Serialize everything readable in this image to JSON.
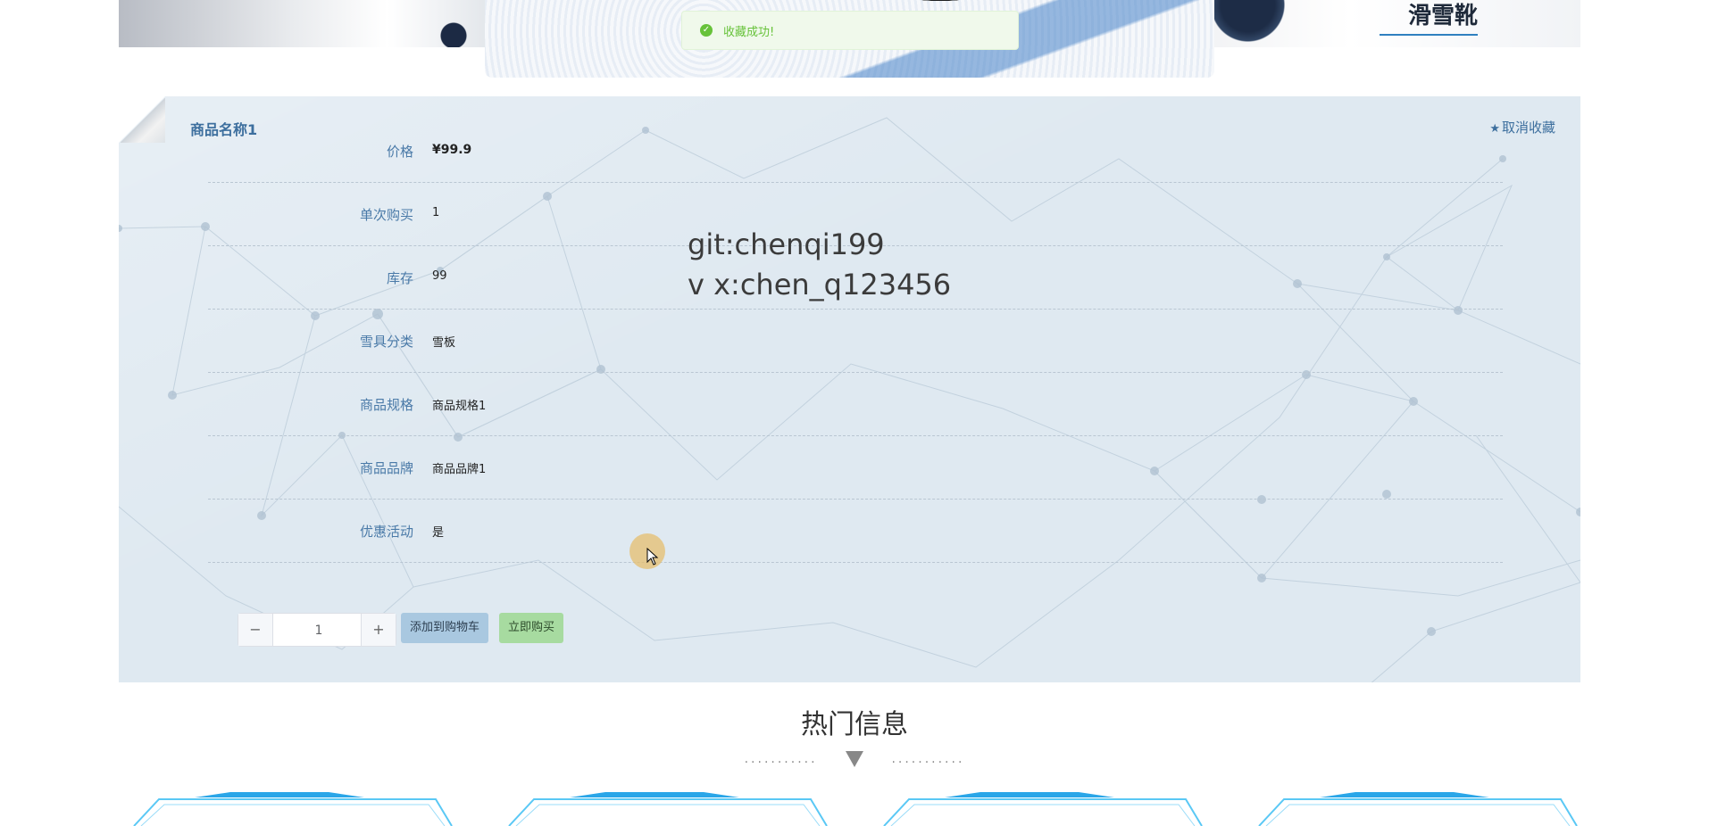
{
  "banner": {
    "right_title": "滑雪靴"
  },
  "toast": {
    "message": "收藏成功!"
  },
  "product": {
    "title": "商品名称1",
    "unfavorite_label": "取消收藏",
    "fields": [
      {
        "label": "价格",
        "value": "¥99.9"
      },
      {
        "label": "单次购买",
        "value": "1"
      },
      {
        "label": "库存",
        "value": "99"
      },
      {
        "label": "雪具分类",
        "value": "雪板"
      },
      {
        "label": "商品规格",
        "value": "商品规格1"
      },
      {
        "label": "商品品牌",
        "value": "商品品牌1"
      },
      {
        "label": "优惠活动",
        "value": "是"
      }
    ],
    "quantity": "1",
    "add_to_cart_label": "添加到购物车",
    "buy_now_label": "立即购买"
  },
  "watermark": {
    "line1": "git:chenqi199",
    "line2": "v x:chen_q123456"
  },
  "hot_section": {
    "title": "热门信息",
    "dots_left": "...........",
    "dots_right": "..........."
  },
  "colors": {
    "accent": "#3d6f9e",
    "toast_success": "#67c23a",
    "cart_button": "#a9c8e0",
    "buy_button": "#a7dba0",
    "panel_bg": "#dfe9f1"
  }
}
